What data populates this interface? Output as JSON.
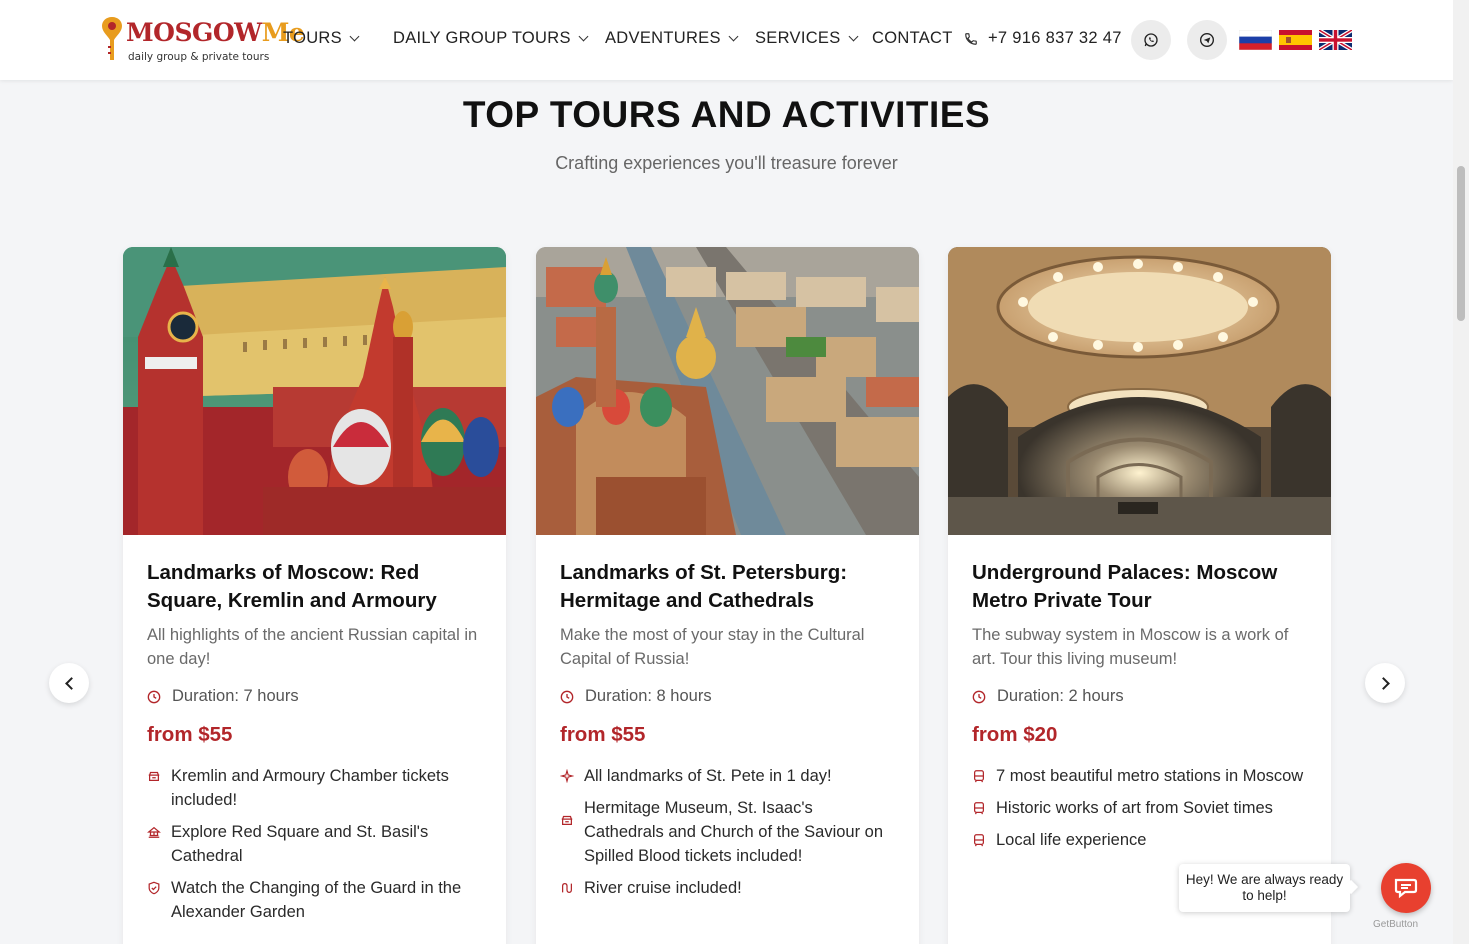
{
  "brand": {
    "name_main": "MOSGOW",
    "name_accent": "Me",
    "tagline": "daily group & private tours",
    "colors": {
      "primary": "#b2262a",
      "accent": "#e89c1e"
    }
  },
  "nav": {
    "items": [
      {
        "label": "TOURS",
        "has_dropdown": true
      },
      {
        "label": "DAILY GROUP TOURS",
        "has_dropdown": true
      },
      {
        "label": "ADVENTURES",
        "has_dropdown": true
      },
      {
        "label": "SERVICES",
        "has_dropdown": true
      },
      {
        "label": "CONTACT",
        "has_dropdown": false
      }
    ],
    "phone": "+7 916 837 32 47",
    "icons": [
      "phone-icon",
      "whatsapp-icon",
      "telegram-icon"
    ],
    "languages": [
      "Russian",
      "Spanish",
      "English"
    ]
  },
  "section": {
    "title": "TOP TOURS AND ACTIVITIES",
    "subtitle": "Crafting experiences you'll treasure forever"
  },
  "tours": [
    {
      "title": "Landmarks of Moscow: Red Square, Kremlin and Armoury",
      "description": "All highlights of the ancient Russian capital in one day!",
      "duration": "Duration: 7 hours",
      "price": "from $55",
      "features": [
        {
          "icon": "ticket-icon",
          "text": "Kremlin and Armoury Chamber tickets included!"
        },
        {
          "icon": "landmark-icon",
          "text": "Explore Red Square and St. Basil's Cathedral"
        },
        {
          "icon": "shield-icon",
          "text": "Watch the Changing of the Guard in the Alexander Garden"
        }
      ]
    },
    {
      "title": "Landmarks of St. Petersburg: Hermitage and Cathedrals",
      "description": "Make the most of your stay in the Cultural Capital of Russia!",
      "duration": "Duration: 8 hours",
      "price": "from $55",
      "features": [
        {
          "icon": "sparkle-icon",
          "text": "All landmarks of St. Pete in 1 day!"
        },
        {
          "icon": "ticket-icon",
          "text": "Hermitage Museum, St. Isaac's Cathedrals and Church of the Saviour on Spilled Blood tickets included!"
        },
        {
          "icon": "route-icon",
          "text": "River cruise included!"
        }
      ]
    },
    {
      "title": "Underground Palaces: Moscow Metro Private Tour",
      "description": "The subway system in Moscow is a work of art. Tour this living museum!",
      "duration": "Duration: 2 hours",
      "price": "from $20",
      "features": [
        {
          "icon": "metro-icon",
          "text": "7 most beautiful metro stations in Moscow"
        },
        {
          "icon": "metro-icon",
          "text": "Historic works of art from Soviet times"
        },
        {
          "icon": "metro-icon",
          "text": "Local life experience"
        }
      ]
    }
  ],
  "chat": {
    "message": "Hey! We are always ready to help!",
    "powered_by": "GetButton"
  }
}
